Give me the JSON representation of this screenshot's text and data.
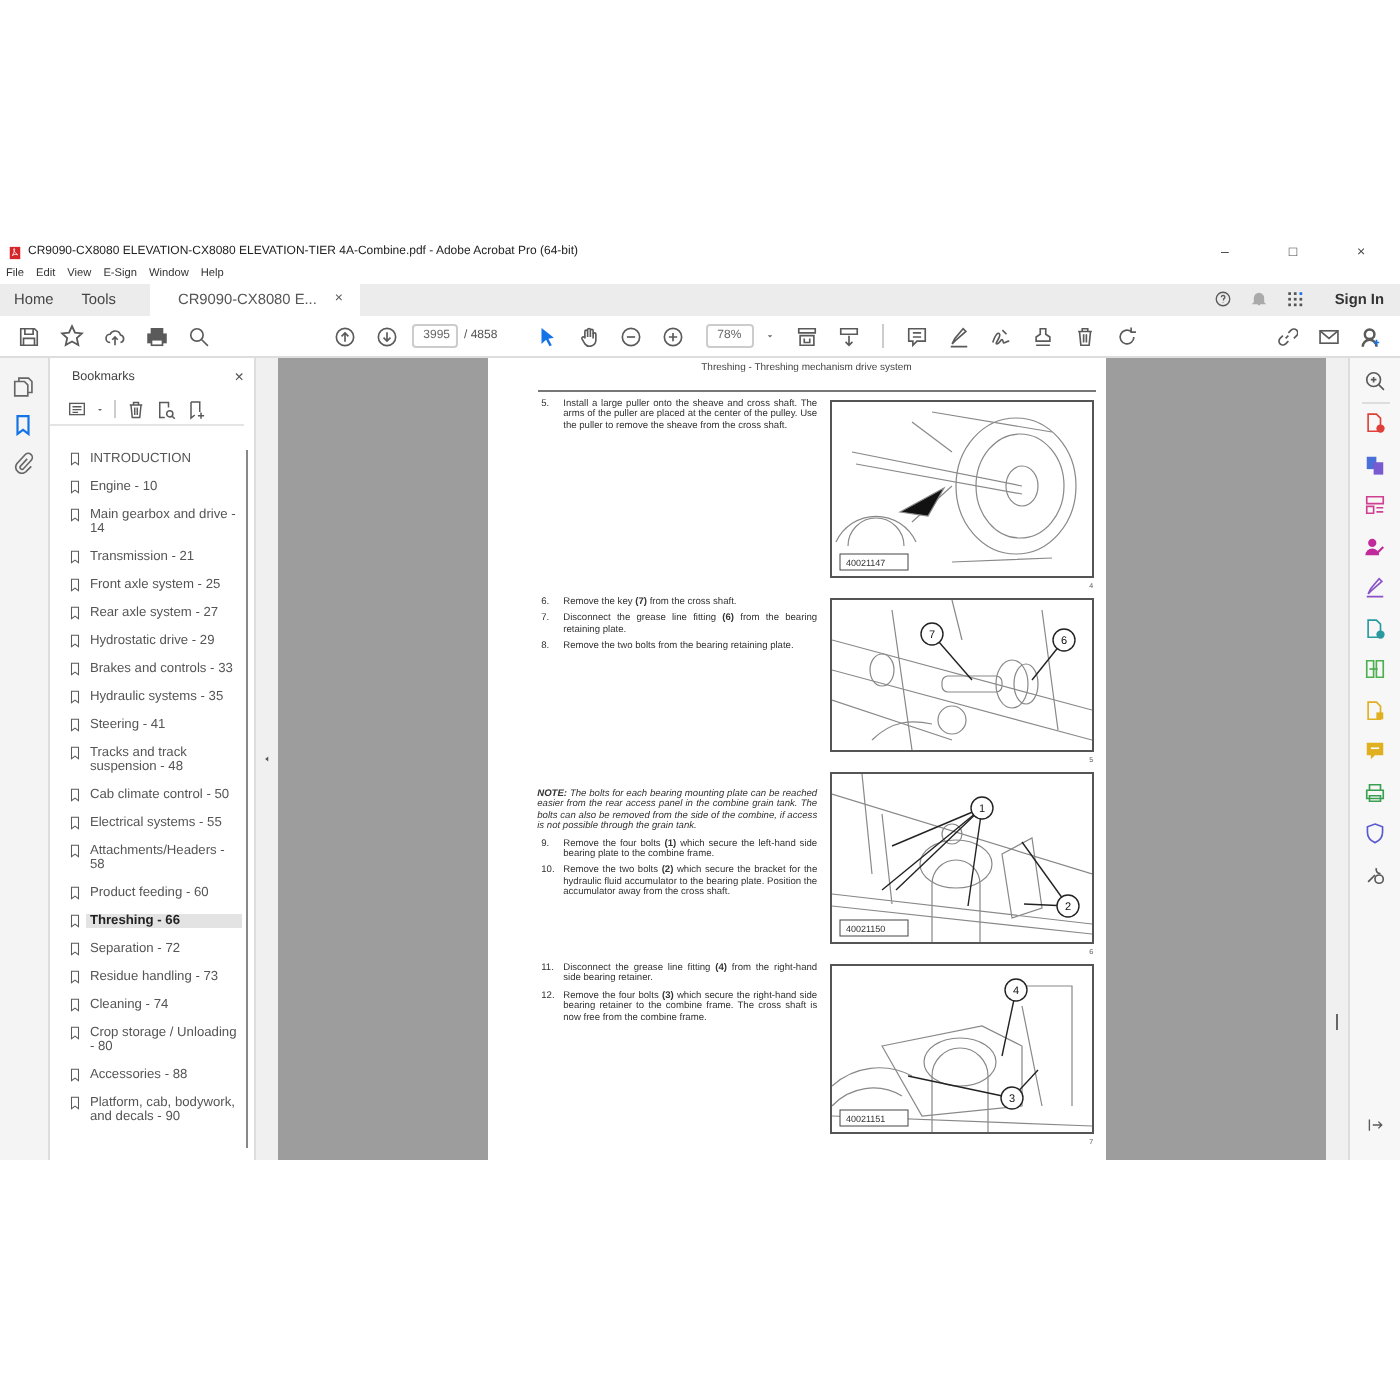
{
  "window": {
    "title": "CR9090-CX8080 ELEVATION-CX8080 ELEVATION-TIER 4A-Combine.pdf - Adobe Acrobat Pro (64-bit)",
    "controls": [
      "–",
      "□",
      "×"
    ]
  },
  "menu": [
    "File",
    "Edit",
    "View",
    "E-Sign",
    "Window",
    "Help"
  ],
  "tabs": [
    {
      "label": "Home",
      "selected": false
    },
    {
      "label": "Tools",
      "selected": false
    },
    {
      "label": "CR9090-CX8080 E...",
      "selected": true,
      "close": "×"
    }
  ],
  "account": {
    "sign_in": "Sign In"
  },
  "toolbar": {
    "page": "3995",
    "page_count": "/ 4858",
    "zoom": "78%"
  },
  "sidebar": {
    "left_rail": [
      {
        "kind": "pages",
        "selected": false
      },
      {
        "kind": "bookmarks",
        "selected": true
      },
      {
        "kind": "attachments",
        "selected": false
      }
    ],
    "title": "Bookmarks",
    "close": "×",
    "bookmarks": [
      {
        "label": "INTRODUCTION",
        "selected": false
      },
      {
        "label": "Engine - 10",
        "selected": false
      },
      {
        "label": "Main gearbox and drive - 14",
        "selected": false
      },
      {
        "label": "Transmission - 21",
        "selected": false
      },
      {
        "label": "Front axle system - 25",
        "selected": false
      },
      {
        "label": "Rear axle system - 27",
        "selected": false
      },
      {
        "label": "Hydrostatic drive - 29",
        "selected": false
      },
      {
        "label": "Brakes and controls - 33",
        "selected": false
      },
      {
        "label": "Hydraulic systems - 35",
        "selected": false
      },
      {
        "label": "Steering - 41",
        "selected": false
      },
      {
        "label": "Tracks and track suspension - 48",
        "selected": false
      },
      {
        "label": "Cab climate control - 50",
        "selected": false
      },
      {
        "label": "Electrical systems - 55",
        "selected": false
      },
      {
        "label": "Attachments/Headers - 58",
        "selected": false
      },
      {
        "label": "Product feeding - 60",
        "selected": false
      },
      {
        "label": "Threshing - 66",
        "selected": true
      },
      {
        "label": "Separation - 72",
        "selected": false
      },
      {
        "label": "Residue handling - 73",
        "selected": false
      },
      {
        "label": "Cleaning - 74",
        "selected": false
      },
      {
        "label": "Crop storage / Unloading - 80",
        "selected": false
      },
      {
        "label": "Accessories - 88",
        "selected": false
      },
      {
        "label": "Platform, cab, bodywork, and decals - 90",
        "selected": false
      }
    ]
  },
  "document": {
    "header": "Threshing - Threshing mechanism drive system",
    "sections": [
      {
        "steps": [
          {
            "number": "5.",
            "text": "Install a large puller onto the sheave and cross shaft. The arms of the puller are placed at the center of the pulley.  Use the puller to remove the sheave from the cross shaft."
          }
        ],
        "figure": {
          "kind": "pulley",
          "id": "40021147",
          "number": "4"
        }
      },
      {
        "steps": [
          {
            "number": "6.",
            "text": "Remove the key **(7)** from the cross shaft."
          },
          {
            "number": "7.",
            "text": "Disconnect the grease line fitting **(6)** from the bearing retaining plate."
          },
          {
            "number": "8.",
            "text": "Remove the two bolts from the bearing retaining plate."
          }
        ],
        "figure": {
          "kind": "shaft",
          "callouts": [
            "7",
            "6"
          ],
          "number": "5"
        }
      },
      {
        "note": "**NOTE:** The bolts for each bearing mounting plate can be reached easier from the rear access panel in the combine grain tank.  The bolts can also be removed from the side of the combine, if access is not possible through the grain tank.",
        "steps": [
          {
            "number": "9.",
            "text": "Remove the four bolts **(1)** which secure the left-hand side bearing plate to the combine frame."
          },
          {
            "number": "10.",
            "text": "Remove the two bolts **(2)** which secure the bracket for the hydraulic fluid accumulator to the bearing plate. Position the accumulator away from the cross shaft."
          }
        ],
        "figure": {
          "kind": "plate",
          "id": "40021150",
          "callouts": [
            "1",
            "2"
          ],
          "number": "6"
        }
      },
      {
        "steps": [
          {
            "number": "11.",
            "text": "Disconnect the grease line fitting **(4)** from the right-hand side bearing retainer."
          },
          {
            "number": "12.",
            "text": "Remove the four bolts **(3)** which secure the right-hand side bearing retainer to the combine frame.  The cross shaft is now free from the combine frame."
          }
        ],
        "figure": {
          "kind": "retainer",
          "id": "40021151",
          "callouts": [
            "4",
            "3"
          ],
          "number": "7"
        }
      }
    ]
  }
}
